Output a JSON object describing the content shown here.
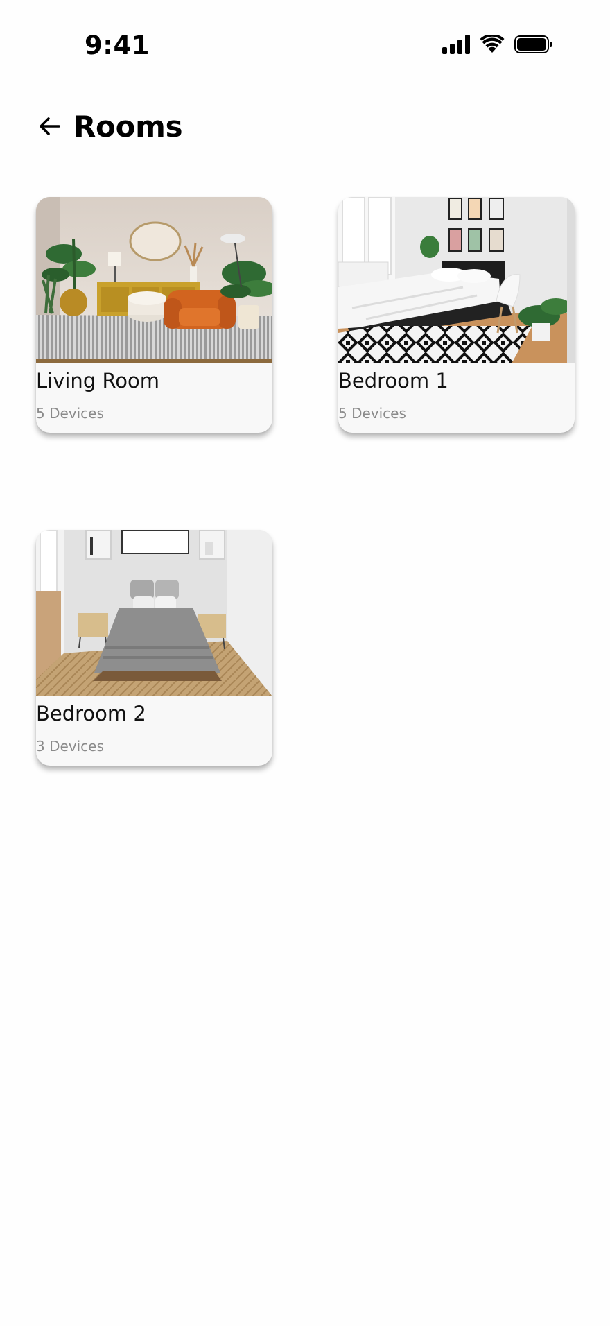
{
  "status_bar": {
    "time": "9:41",
    "icons": [
      "signal-icon",
      "wifi-icon",
      "battery-icon"
    ]
  },
  "header": {
    "back_icon": "arrow-left-icon",
    "title": "Rooms"
  },
  "rooms": [
    {
      "name": "Living Room",
      "devices": "5 Devices",
      "image": "living-room-photo"
    },
    {
      "name": "Bedroom 1",
      "devices": "5 Devices",
      "image": "bedroom-1-photo"
    },
    {
      "name": "Bedroom 2",
      "devices": "3 Devices",
      "image": "bedroom-2-photo"
    }
  ],
  "colors": {
    "background": "#fefefe",
    "card": "#f8f8f8",
    "secondary_text": "#8a8a8a",
    "accent_orange": "#d2641f"
  }
}
